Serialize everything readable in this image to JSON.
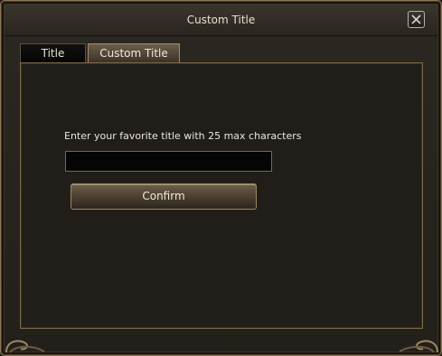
{
  "window": {
    "title": "Custom Title",
    "close_icon": "close-icon"
  },
  "tabs": [
    {
      "label": "Title",
      "active": false
    },
    {
      "label": "Custom Title",
      "active": true
    }
  ],
  "form": {
    "prompt": "Enter your favorite title with 25 max characters",
    "input_value": "",
    "max_length": "25",
    "confirm_label": "Confirm"
  },
  "colors": {
    "frame_gold": "#8c7552",
    "panel_bg": "#211e19",
    "text": "#e9e6de"
  }
}
